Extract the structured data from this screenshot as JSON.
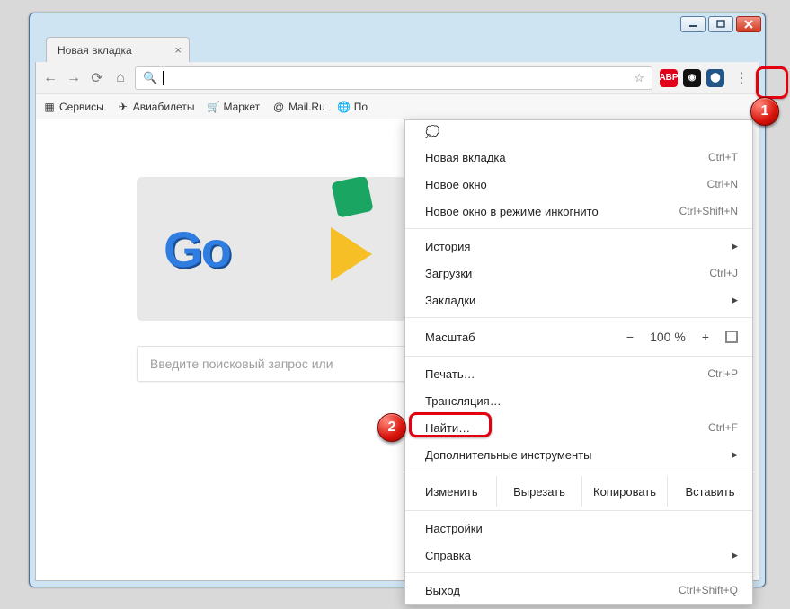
{
  "window": {
    "title": ""
  },
  "tabs": {
    "active": {
      "title": "Новая вкладка"
    }
  },
  "bookmarks": {
    "apps": "Сервисы",
    "b1": "Авиабилеты",
    "b2": "Маркет",
    "b3": "Mail.Ru",
    "b4": "По"
  },
  "ntp": {
    "search_placeholder": "Введите поисковый запрос или"
  },
  "extensions": {
    "abp": "ABP"
  },
  "menu": {
    "new_tab": "Новая вкладка",
    "new_tab_sc": "Ctrl+T",
    "new_window": "Новое окно",
    "new_window_sc": "Ctrl+N",
    "incognito": "Новое окно в режиме инкогнито",
    "incognito_sc": "Ctrl+Shift+N",
    "history": "История",
    "downloads": "Загрузки",
    "downloads_sc": "Ctrl+J",
    "bookmarks": "Закладки",
    "zoom_label": "Масштаб",
    "zoom_value": "100 %",
    "print": "Печать…",
    "print_sc": "Ctrl+P",
    "cast": "Трансляция…",
    "find": "Найти…",
    "find_sc": "Ctrl+F",
    "more_tools": "Дополнительные инструменты",
    "edit_label": "Изменить",
    "cut": "Вырезать",
    "copy": "Копировать",
    "paste": "Вставить",
    "settings": "Настройки",
    "help": "Справка",
    "exit": "Выход",
    "exit_sc": "Ctrl+Shift+Q"
  },
  "callouts": {
    "one": "1",
    "two": "2"
  }
}
